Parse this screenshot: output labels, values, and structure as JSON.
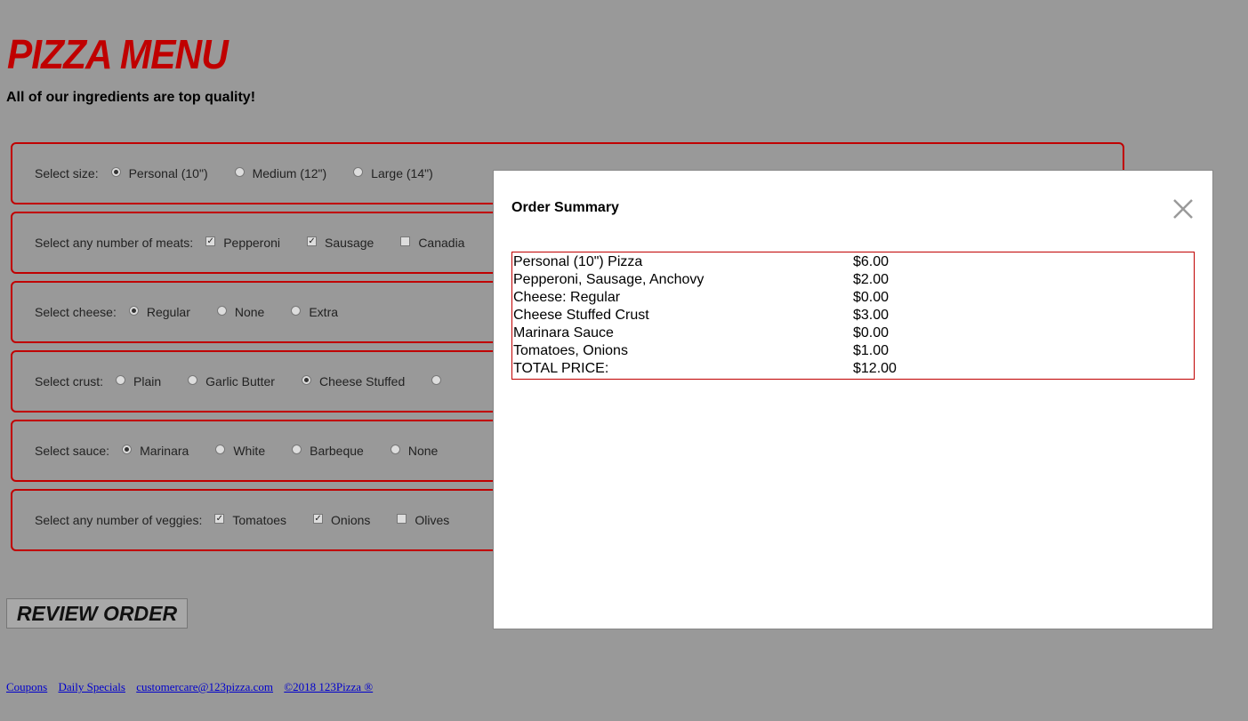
{
  "page": {
    "title": "PIZZA MENU",
    "subtitle": "All of our ingredients are top quality!"
  },
  "sections": [
    {
      "label": "Select size:",
      "type": "radio",
      "options": [
        {
          "text": "Personal (10\")",
          "checked": true
        },
        {
          "text": "Medium (12\")",
          "checked": false
        },
        {
          "text": "Large (14\")",
          "checked": false
        }
      ]
    },
    {
      "label": "Select any number of meats:",
      "type": "check",
      "options": [
        {
          "text": "Pepperoni",
          "checked": true
        },
        {
          "text": "Sausage",
          "checked": true
        },
        {
          "text": "Canadia",
          "checked": false
        }
      ]
    },
    {
      "label": "Select cheese:",
      "type": "radio",
      "options": [
        {
          "text": "Regular",
          "checked": true
        },
        {
          "text": "None",
          "checked": false
        },
        {
          "text": "Extra",
          "checked": false
        }
      ]
    },
    {
      "label": "Select crust:",
      "type": "radio",
      "options": [
        {
          "text": "Plain",
          "checked": false
        },
        {
          "text": "Garlic Butter",
          "checked": false
        },
        {
          "text": "Cheese Stuffed",
          "checked": true
        },
        {
          "text": "",
          "checked": false
        }
      ]
    },
    {
      "label": "Select sauce:",
      "type": "radio",
      "options": [
        {
          "text": "Marinara",
          "checked": true
        },
        {
          "text": "White",
          "checked": false
        },
        {
          "text": "Barbeque",
          "checked": false
        },
        {
          "text": "None",
          "checked": false
        }
      ]
    },
    {
      "label": "Select any number of veggies:",
      "type": "check",
      "options": [
        {
          "text": "Tomatoes",
          "checked": true
        },
        {
          "text": "Onions",
          "checked": true
        },
        {
          "text": "Olives",
          "checked": false
        }
      ]
    }
  ],
  "review_button": "REVIEW ORDER",
  "footer": {
    "links": [
      "Coupons",
      "Daily Specials",
      "customercare@123pizza.com",
      "©2018 123Pizza ®"
    ]
  },
  "modal": {
    "title": "Order Summary",
    "rows": [
      {
        "item": "Personal (10\") Pizza",
        "price": "$6.00"
      },
      {
        "item": "Pepperoni, Sausage, Anchovy",
        "price": "$2.00"
      },
      {
        "item": "Cheese: Regular",
        "price": "$0.00"
      },
      {
        "item": "Cheese Stuffed Crust",
        "price": "$3.00"
      },
      {
        "item": "Marinara Sauce",
        "price": "$0.00"
      },
      {
        "item": "Tomatoes, Onions",
        "price": "$1.00"
      },
      {
        "item": "TOTAL PRICE:",
        "price": "$12.00"
      }
    ]
  },
  "colors": {
    "accent": "#c00000",
    "overlay": "#999999",
    "link": "#0000cc"
  },
  "icons": {
    "close": "close-icon"
  }
}
